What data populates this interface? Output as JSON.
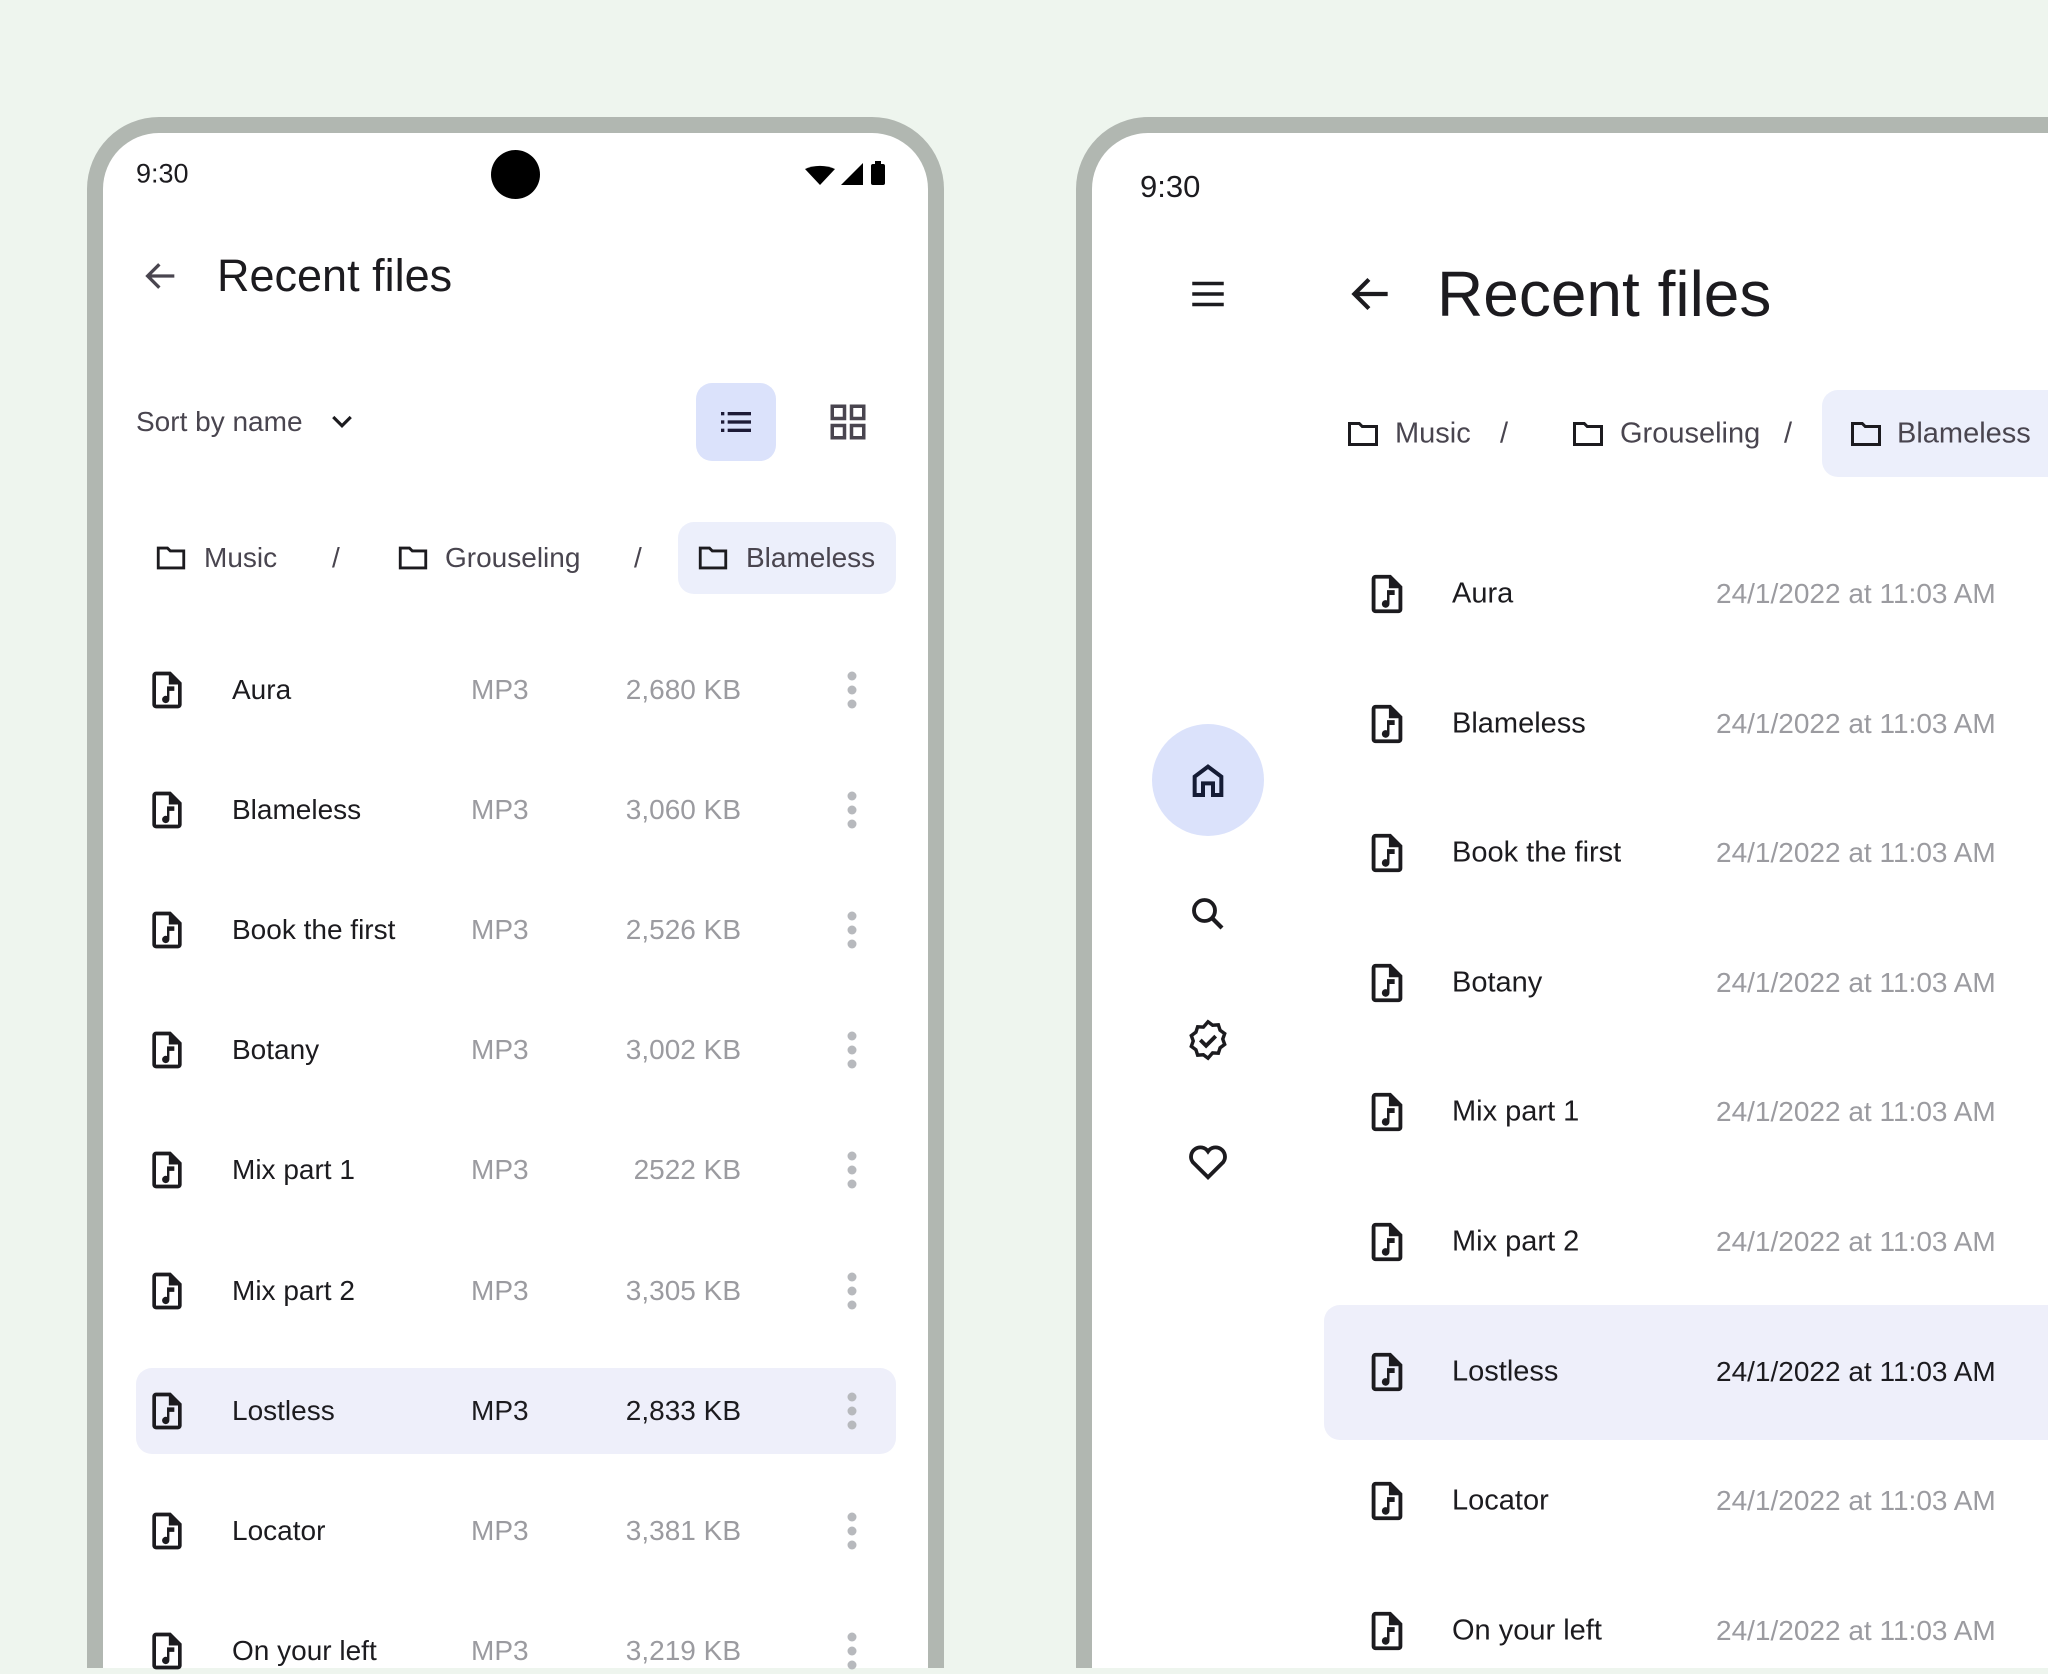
{
  "colors": {
    "background": "#eef5ee",
    "frame": "#b1b7b1",
    "selected_chip": "#eceffb",
    "selected_toggle": "#dbe2fb",
    "selected_row": "#eeeffa",
    "nav_active": "#dbe2fb"
  },
  "phone": {
    "status": {
      "time": "9:30",
      "icons": [
        "wifi-icon",
        "signal-icon",
        "battery-icon"
      ]
    },
    "header": {
      "title": "Recent files",
      "back_icon": "arrow-back-icon"
    },
    "toolbar": {
      "sort_label": "Sort by name",
      "view_mode": "list"
    },
    "breadcrumbs": [
      {
        "label": "Music"
      },
      {
        "label": "Grouseling"
      },
      {
        "label": "Blameless",
        "selected": true
      }
    ],
    "breadcrumb_separator": "/",
    "files": [
      {
        "name": "Aura",
        "type": "MP3",
        "size": "2,680 KB"
      },
      {
        "name": "Blameless",
        "type": "MP3",
        "size": "3,060 KB"
      },
      {
        "name": "Book the first",
        "type": "MP3",
        "size": "2,526 KB"
      },
      {
        "name": "Botany",
        "type": "MP3",
        "size": "3,002 KB"
      },
      {
        "name": "Mix part 1",
        "type": "MP3",
        "size": "2522 KB"
      },
      {
        "name": "Mix part 2",
        "type": "MP3",
        "size": "3,305 KB"
      },
      {
        "name": "Lostless",
        "type": "MP3",
        "size": "2,833 KB",
        "selected": true
      },
      {
        "name": "Locator",
        "type": "MP3",
        "size": "3,381 KB"
      },
      {
        "name": "On your left",
        "type": "MP3",
        "size": "3,219 KB"
      }
    ]
  },
  "tablet": {
    "status": {
      "time": "9:30"
    },
    "header": {
      "title": "Recent files",
      "menu_icon": "menu-icon",
      "back_icon": "arrow-back-icon"
    },
    "nav_rail": [
      {
        "icon": "home-icon",
        "active": true
      },
      {
        "icon": "search-icon"
      },
      {
        "icon": "verified-icon"
      },
      {
        "icon": "heart-icon"
      }
    ],
    "breadcrumbs": [
      {
        "label": "Music"
      },
      {
        "label": "Grouseling"
      },
      {
        "label": "Blameless",
        "selected": true
      }
    ],
    "breadcrumb_separator": "/",
    "files": [
      {
        "name": "Aura",
        "date": "24/1/2022 at 11:03 AM"
      },
      {
        "name": "Blameless",
        "date": "24/1/2022 at 11:03 AM"
      },
      {
        "name": "Book the first",
        "date": "24/1/2022 at 11:03 AM"
      },
      {
        "name": "Botany",
        "date": "24/1/2022 at 11:03 AM"
      },
      {
        "name": "Mix part 1",
        "date": "24/1/2022 at 11:03 AM"
      },
      {
        "name": "Mix part 2",
        "date": "24/1/2022 at 11:03 AM"
      },
      {
        "name": "Lostless",
        "date": "24/1/2022 at 11:03 AM",
        "selected": true
      },
      {
        "name": "Locator",
        "date": "24/1/2022 at 11:03 AM"
      },
      {
        "name": "On your left",
        "date": "24/1/2022 at 11:03 AM"
      }
    ]
  }
}
